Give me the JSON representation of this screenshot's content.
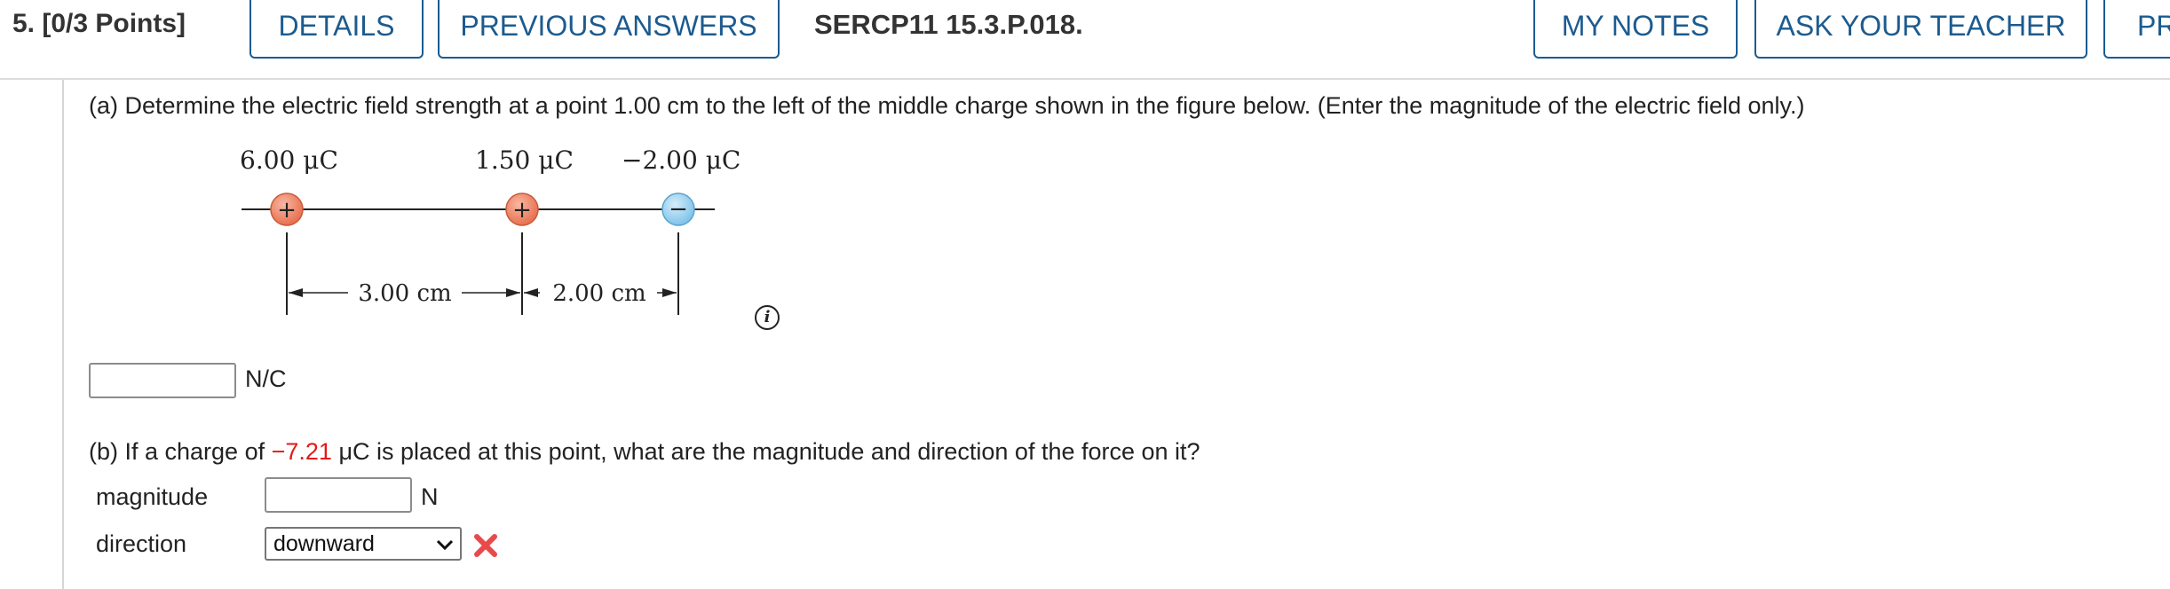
{
  "header": {
    "question": "5.  [0/3 Points]",
    "details_label": "DETAILS",
    "previous_answers_label": "PREVIOUS ANSWERS",
    "problem_id": "SERCP11 15.3.P.018.",
    "my_notes_label": "MY NOTES",
    "ask_teacher_label": "ASK YOUR TEACHER",
    "practice_label": "PR"
  },
  "part_a": {
    "prompt": "(a) Determine the electric field strength at a point 1.00 cm to the left of the middle charge shown in the figure below. (Enter the magnitude of the electric field only.)",
    "unit": "N/C",
    "input_value": ""
  },
  "figure": {
    "charge1_label": "6.00 μC",
    "charge2_label": "1.50 μC",
    "charge3_label": "−2.00 μC",
    "charge1_sign": "+",
    "charge2_sign": "+",
    "charge3_sign": "−",
    "distance1_label": "3.00 cm",
    "distance2_label": "2.00 cm",
    "positive_color": "#e8704f",
    "negative_color": "#7fc3ea"
  },
  "info_icon_glyph": "i",
  "part_b": {
    "prompt_prefix": "(b) If a charge of ",
    "charge_value": "−7.21",
    "prompt_suffix": " μC is placed at this point, what are the magnitude and direction of the force on it?",
    "magnitude_label": "magnitude",
    "magnitude_unit": "N",
    "magnitude_value": "",
    "direction_label": "direction",
    "direction_value": "downward",
    "status": "incorrect"
  },
  "colors": {
    "accent": "#1c5b8f",
    "error": "#e41919"
  }
}
